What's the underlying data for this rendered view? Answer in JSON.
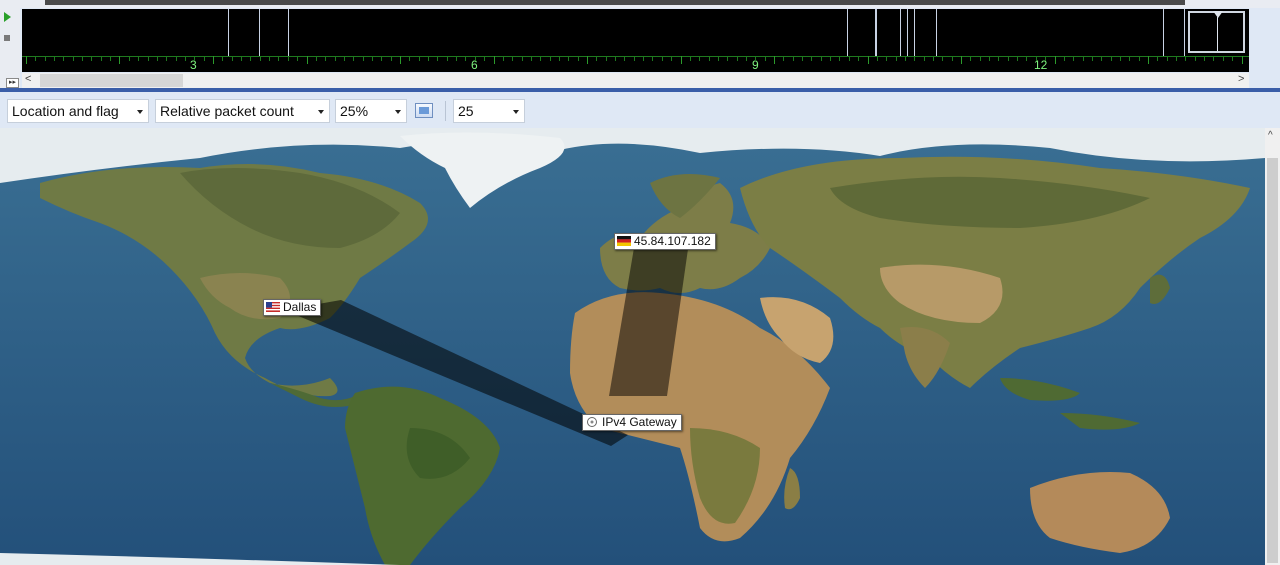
{
  "timeline": {
    "tick_labels": [
      "3",
      "6",
      "9",
      "12"
    ]
  },
  "toolbar": {
    "view_mode": "Location and flag",
    "metric": "Relative packet count",
    "opacity": "25%",
    "limit": "25"
  },
  "map": {
    "nodes": {
      "dallas": "Dallas",
      "germany_ip": "45.84.107.182",
      "gateway": "IPv4 Gateway"
    }
  },
  "colors": {
    "timeline_bg": "#000000",
    "tick_green": "#7ff27f",
    "ocean": "#2f5f86",
    "toolbar_bg": "#dfe8f5"
  },
  "icons": {
    "play": "play-icon",
    "stop": "stop-icon",
    "settings": "layers-settings-icon",
    "flag_us": "us-flag-icon",
    "flag_de": "germany-flag-icon",
    "gateway": "gateway-icon"
  }
}
